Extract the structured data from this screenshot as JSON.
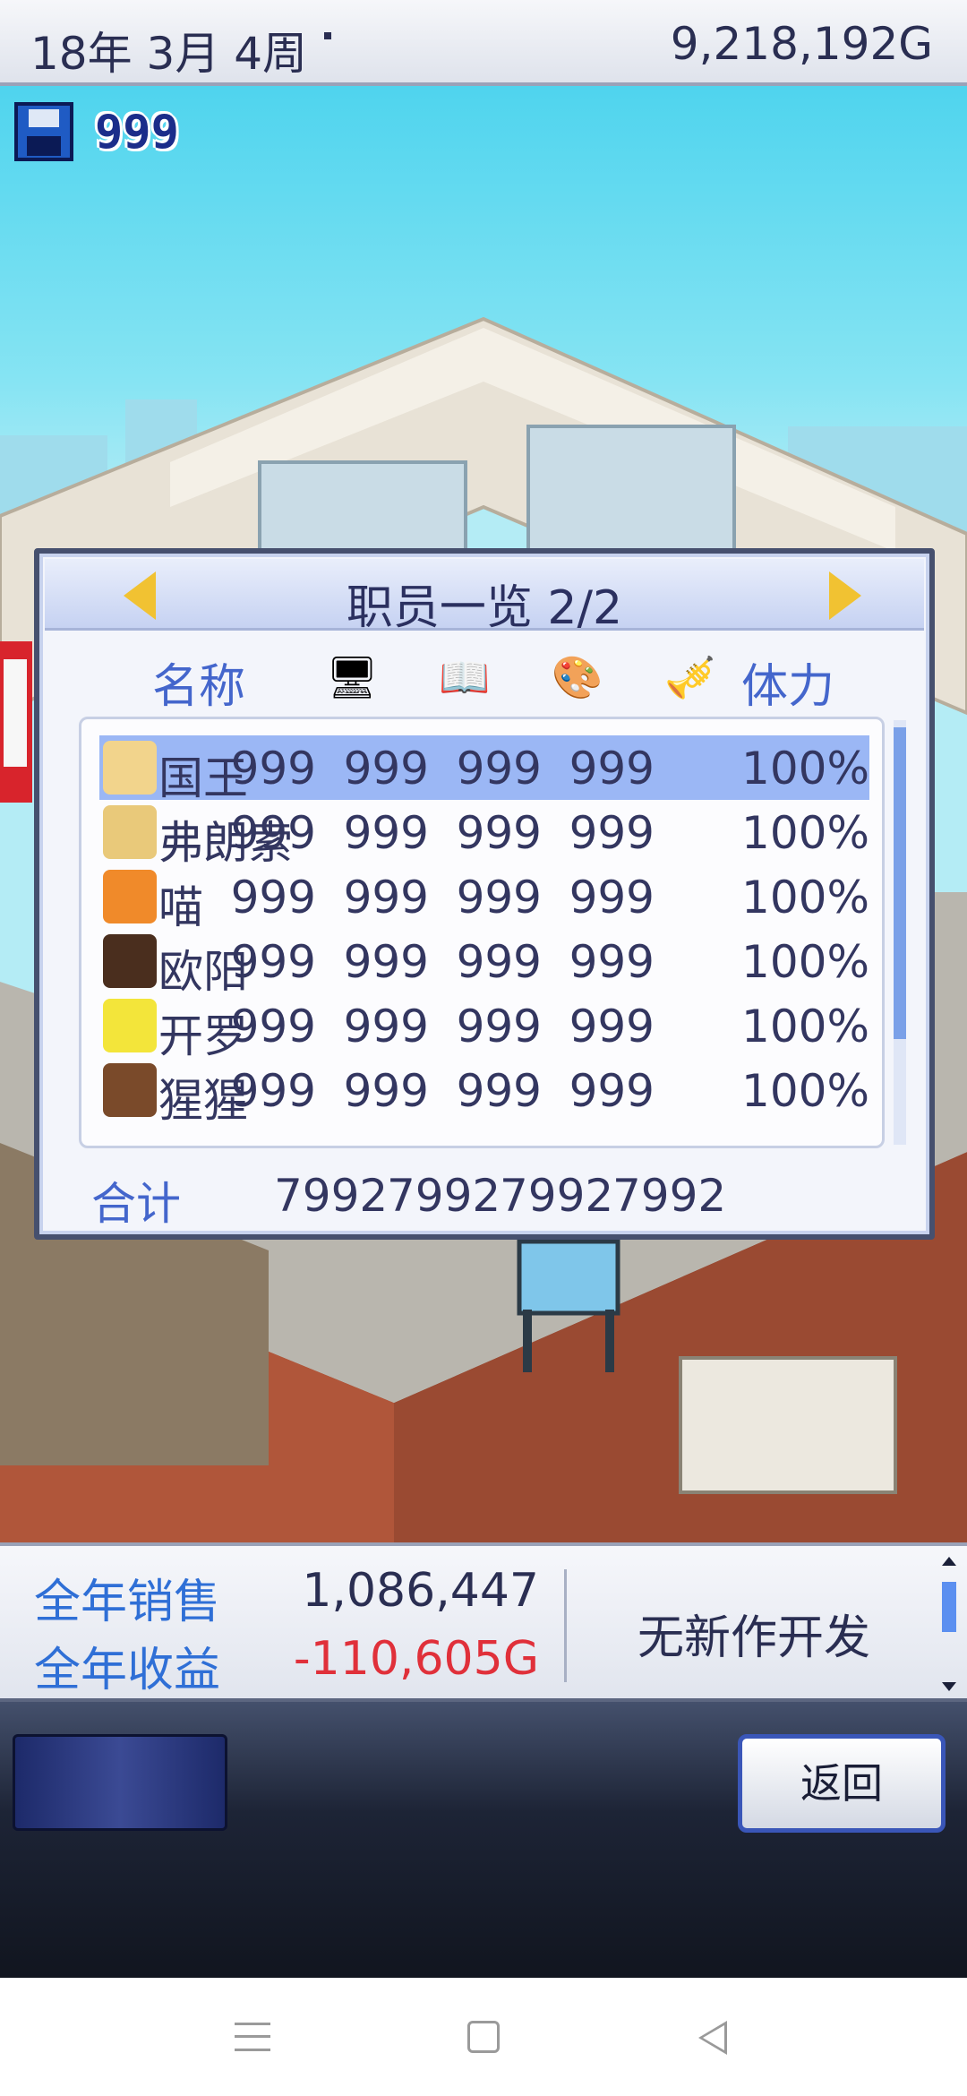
{
  "header": {
    "date": "18年 3月 4周",
    "money": "9,218,192G"
  },
  "save": {
    "count": "999"
  },
  "panel": {
    "title": "职员一览 2/2",
    "columns": {
      "name": "名称",
      "stamina": "体力"
    },
    "stat_icons": [
      "computer-icon",
      "book-icon",
      "paint-palette-icon",
      "trumpet-icon"
    ],
    "rows": [
      {
        "name": "国王",
        "stats": [
          "999",
          "999",
          "999",
          "999"
        ],
        "stamina": "100%",
        "avatar_color": "#f2d48c"
      },
      {
        "name": "弗朗索",
        "stats": [
          "999",
          "999",
          "999",
          "999"
        ],
        "stamina": "100%",
        "avatar_color": "#e9c97a"
      },
      {
        "name": "喵",
        "stats": [
          "999",
          "999",
          "999",
          "999"
        ],
        "stamina": "100%",
        "avatar_color": "#f08a2a"
      },
      {
        "name": "欧阳",
        "stats": [
          "999",
          "999",
          "999",
          "999"
        ],
        "stamina": "100%",
        "avatar_color": "#4a2e1e"
      },
      {
        "name": "开罗",
        "stats": [
          "999",
          "999",
          "999",
          "999"
        ],
        "stamina": "100%",
        "avatar_color": "#f3e53a"
      },
      {
        "name": "猩猩",
        "stats": [
          "999",
          "999",
          "999",
          "999"
        ],
        "stamina": "100%",
        "avatar_color": "#7a4a2a"
      }
    ],
    "total_label": "合计",
    "totals": [
      "7992",
      "7992",
      "7992",
      "7992"
    ]
  },
  "info": {
    "annual_sales_label": "全年销售",
    "annual_sales": "1,086,447",
    "annual_profit_label": "全年收益",
    "annual_profit": "-110,605G",
    "status": "无新作开发"
  },
  "controls": {
    "back_label": "返回"
  },
  "colors": {
    "accent": "#4466cc",
    "selected_row": "#9bb7f5",
    "negative": "#e0303a",
    "arrow": "#f1c232"
  }
}
